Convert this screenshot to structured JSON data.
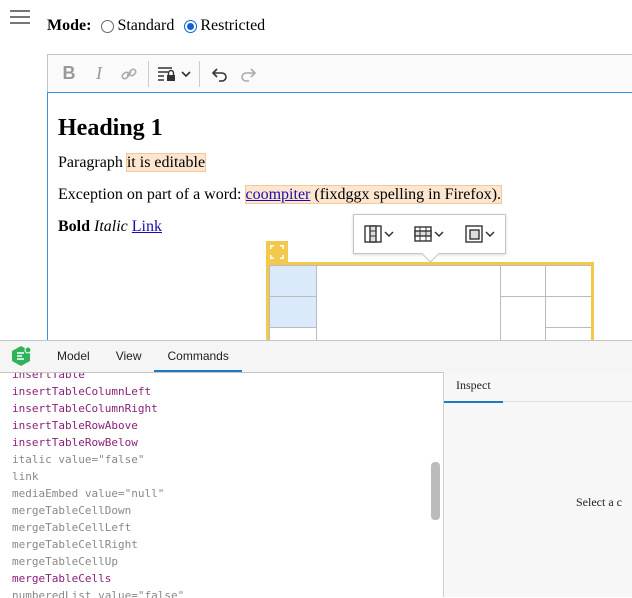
{
  "mode": {
    "label": "Mode",
    "options": [
      "Standard",
      "Restricted"
    ],
    "selected": "Restricted"
  },
  "toolbar": {
    "icons": [
      "bold-icon",
      "italic-icon",
      "link-icon",
      "restricted-editing-icon",
      "undo-icon",
      "redo-icon"
    ]
  },
  "editor": {
    "heading": "Heading 1",
    "p1": {
      "before": "Paragraph ",
      "hl": "it is editable"
    },
    "p2": {
      "before": "Exception on part of a word: ",
      "link": "coompiter",
      "hl": " (fixdggx spelling in Firefox)."
    },
    "p3": {
      "bold": "Bold",
      "italic": "Italic",
      "link": "Link"
    }
  },
  "inspector": {
    "tabs": [
      "Model",
      "View",
      "Commands"
    ],
    "active_tab": "Commands",
    "commands": [
      {
        "text": "insertTable",
        "state": "on"
      },
      {
        "text": "insertTableColumnLeft",
        "state": "on"
      },
      {
        "text": "insertTableColumnRight",
        "state": "on"
      },
      {
        "text": "insertTableRowAbove",
        "state": "on"
      },
      {
        "text": "insertTableRowBelow",
        "state": "on"
      },
      {
        "text": "italic value=\"false\"",
        "state": "off"
      },
      {
        "text": "link",
        "state": "off"
      },
      {
        "text": "mediaEmbed value=\"null\"",
        "state": "off"
      },
      {
        "text": "mergeTableCellDown",
        "state": "off"
      },
      {
        "text": "mergeTableCellLeft",
        "state": "off"
      },
      {
        "text": "mergeTableCellRight",
        "state": "off"
      },
      {
        "text": "mergeTableCellUp",
        "state": "off"
      },
      {
        "text": "mergeTableCells",
        "state": "on"
      },
      {
        "text": "numberedList value=\"false\"",
        "state": "off"
      }
    ],
    "right_tab": "Inspect",
    "select_message": "Select a c"
  },
  "colors": {
    "accent": "#1a7bc0",
    "table_selection": "#f2c94c",
    "editable_highlight": "#fde6cf",
    "command_enabled": "#8b1f7a"
  }
}
